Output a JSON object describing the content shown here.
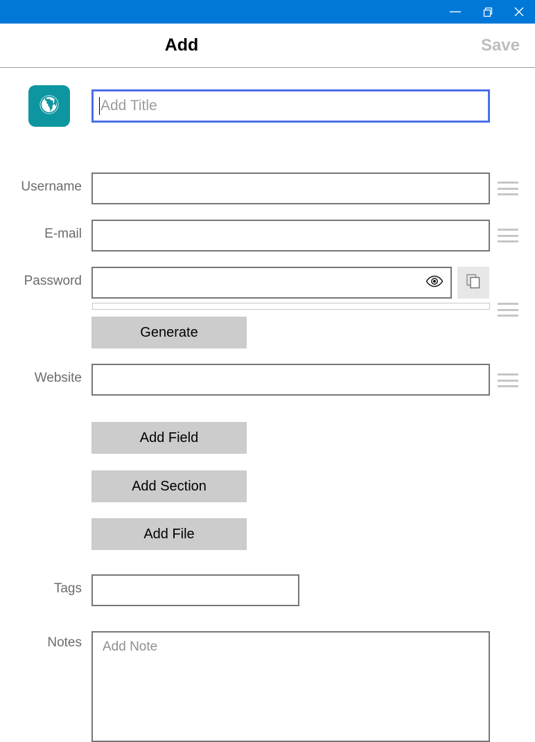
{
  "window": {
    "titlebar_color": "#0078d7",
    "controls": [
      {
        "name": "minimize",
        "label": "Minimize"
      },
      {
        "name": "restore",
        "label": "Restore"
      },
      {
        "name": "close",
        "label": "Close"
      }
    ]
  },
  "header": {
    "title": "Add",
    "save_label": "Save",
    "save_color": "#bdbdbd"
  },
  "entry": {
    "icon_name": "globe-icon",
    "icon_background": "#0d96a0",
    "title_field": {
      "value": "",
      "placeholder": "Add Title",
      "focus_border_color": "#4a6ee8"
    }
  },
  "fields": [
    {
      "label": "Username",
      "value": "",
      "placeholder": ""
    },
    {
      "label": "E-mail",
      "value": "",
      "placeholder": ""
    },
    {
      "label": "Password",
      "value": "",
      "placeholder": ""
    },
    {
      "label": "Website",
      "value": "",
      "placeholder": ""
    }
  ],
  "password": {
    "reveal_icon": "eye-icon",
    "copy_icon": "copy-icon",
    "strength_value": 0,
    "generate_label": "Generate"
  },
  "actions": [
    {
      "label": "Add Field"
    },
    {
      "label": "Add Section"
    },
    {
      "label": "Add File"
    }
  ],
  "tags": {
    "label": "Tags",
    "value": "",
    "placeholder": ""
  },
  "notes": {
    "label": "Notes",
    "value": "",
    "placeholder": "Add Note"
  }
}
